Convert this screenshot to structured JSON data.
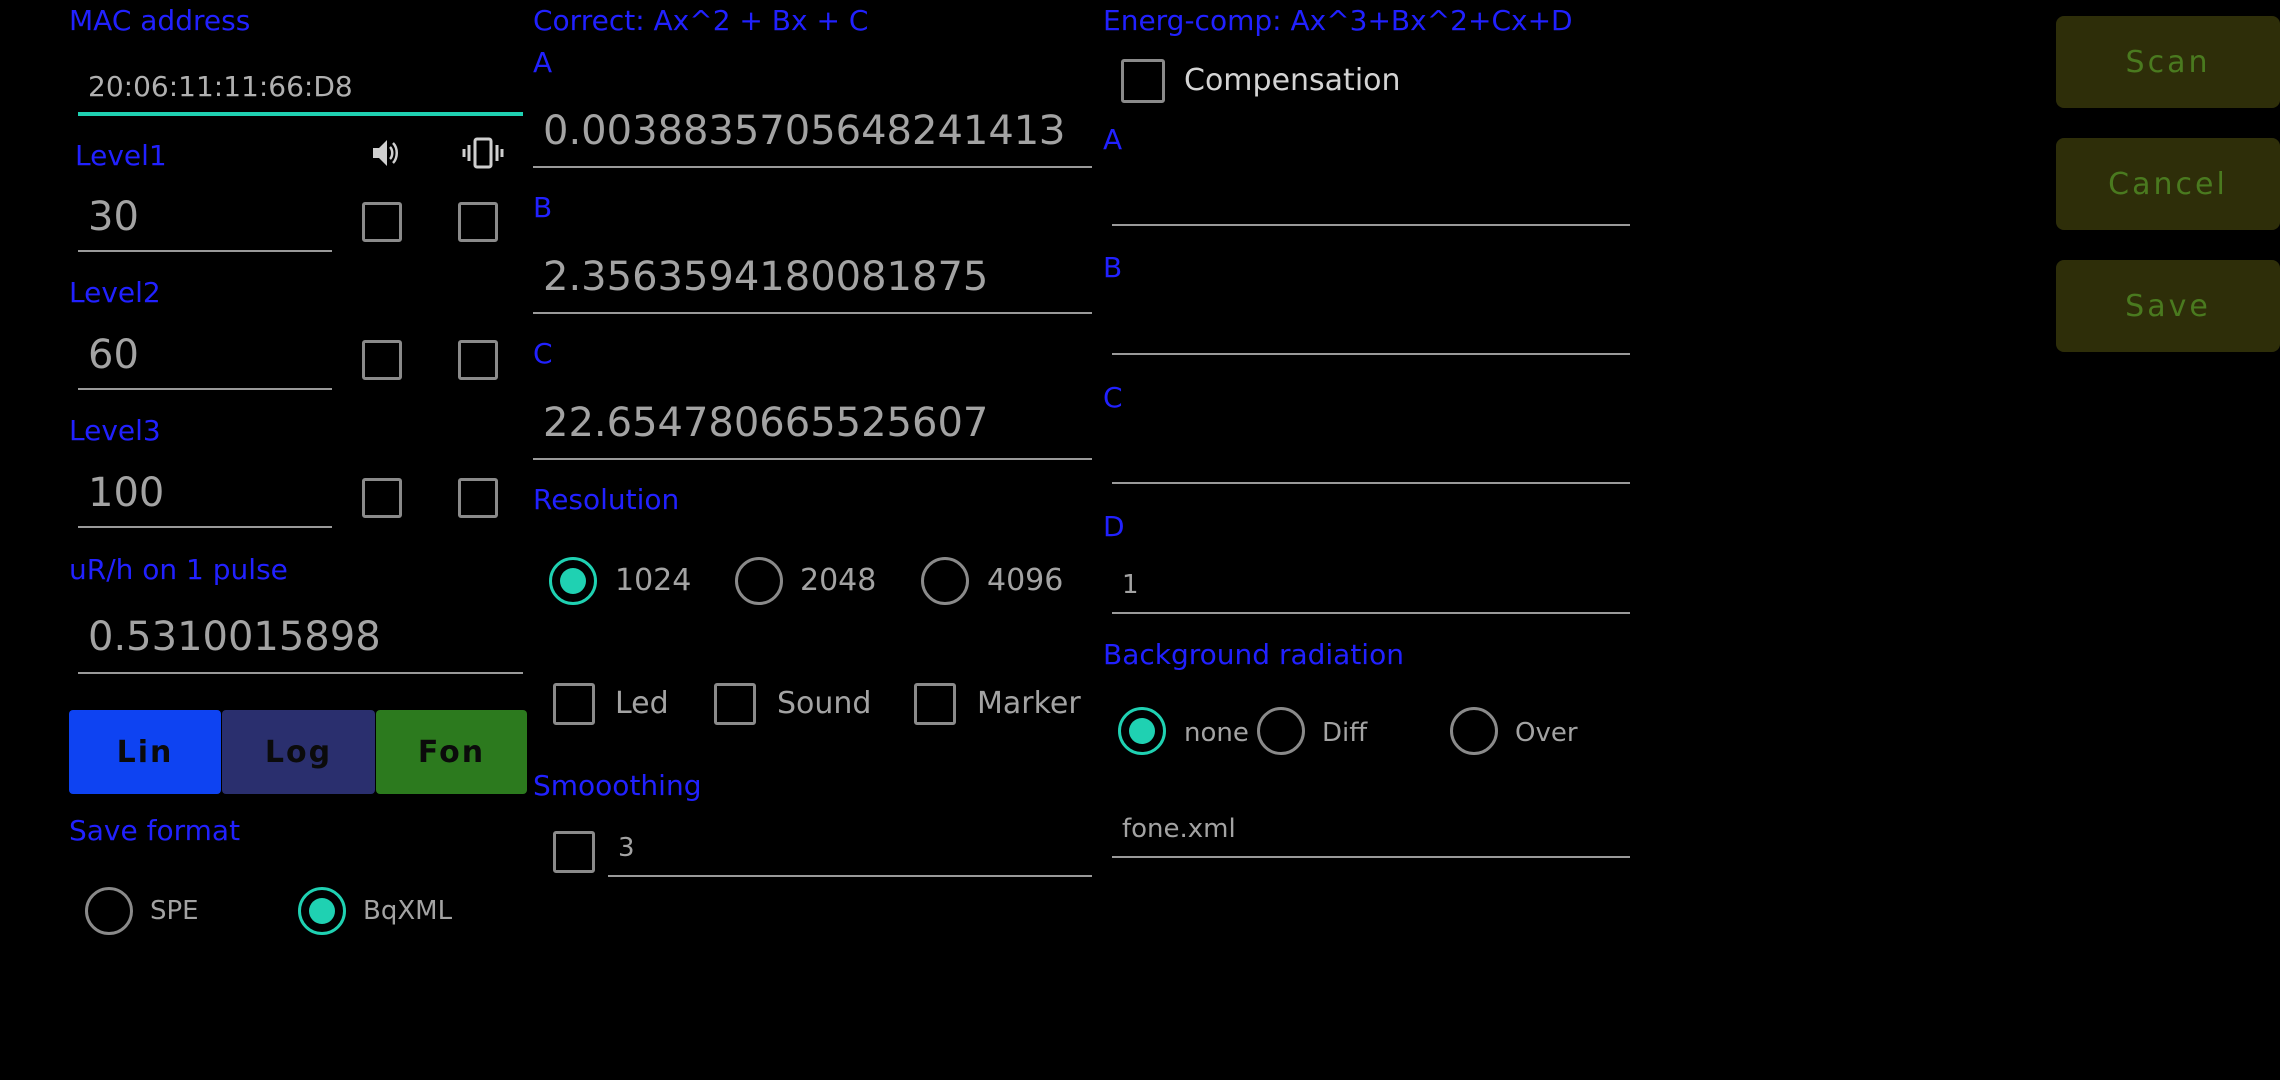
{
  "left": {
    "mac_label": "MAC address",
    "mac_value": "20:06:11:11:66:D8",
    "levels": [
      {
        "label": "Level1",
        "value": "30"
      },
      {
        "label": "Level2",
        "value": "60"
      },
      {
        "label": "Level3",
        "value": "100"
      }
    ],
    "pulse_label": "uR/h on 1 pulse",
    "pulse_value": "0.5310015898",
    "scale_buttons": {
      "lin": "Lin",
      "log": "Log",
      "fon": "Fon"
    },
    "save_format_label": "Save format",
    "save_formats": [
      {
        "label": "SPE",
        "selected": false
      },
      {
        "label": "BqXML",
        "selected": true
      }
    ]
  },
  "correct": {
    "title": "Correct: Ax^2 + Bx + C",
    "a_label": "A",
    "a_value": "0.003883570564824141З",
    "b_label": "B",
    "b_value": "2.3563594180081875",
    "c_label": "C",
    "c_value": "22.654780665525607",
    "resolution_label": "Resolution",
    "resolutions": [
      {
        "label": "1024",
        "selected": true
      },
      {
        "label": "2048",
        "selected": false
      },
      {
        "label": "4096",
        "selected": false
      }
    ],
    "flags": [
      "Led",
      "Sound",
      "Marker"
    ],
    "smoothing_label": "Smooothing",
    "smoothing_value": "3"
  },
  "energ": {
    "title": "Energ-comp: Ax^3+Bx^2+Cx+D",
    "compensation_label": "Compensation",
    "a_label": "A",
    "b_label": "B",
    "c_label": "C",
    "d_label": "D",
    "d_value": "1",
    "background_label": "Background radiation",
    "background_options": [
      {
        "label": "none",
        "selected": true
      },
      {
        "label": "Diff",
        "selected": false
      },
      {
        "label": "Over",
        "selected": false
      }
    ],
    "background_file": "fone.xml"
  },
  "actions": {
    "scan": "Scan",
    "cancel": "Cancel",
    "save": "Save"
  },
  "colors": {
    "label_blue": "#2121ff",
    "accent_teal": "#1fd1b2",
    "lin": "#0e43f2",
    "log": "#2a2f6e",
    "fon": "#2c7a1e"
  }
}
